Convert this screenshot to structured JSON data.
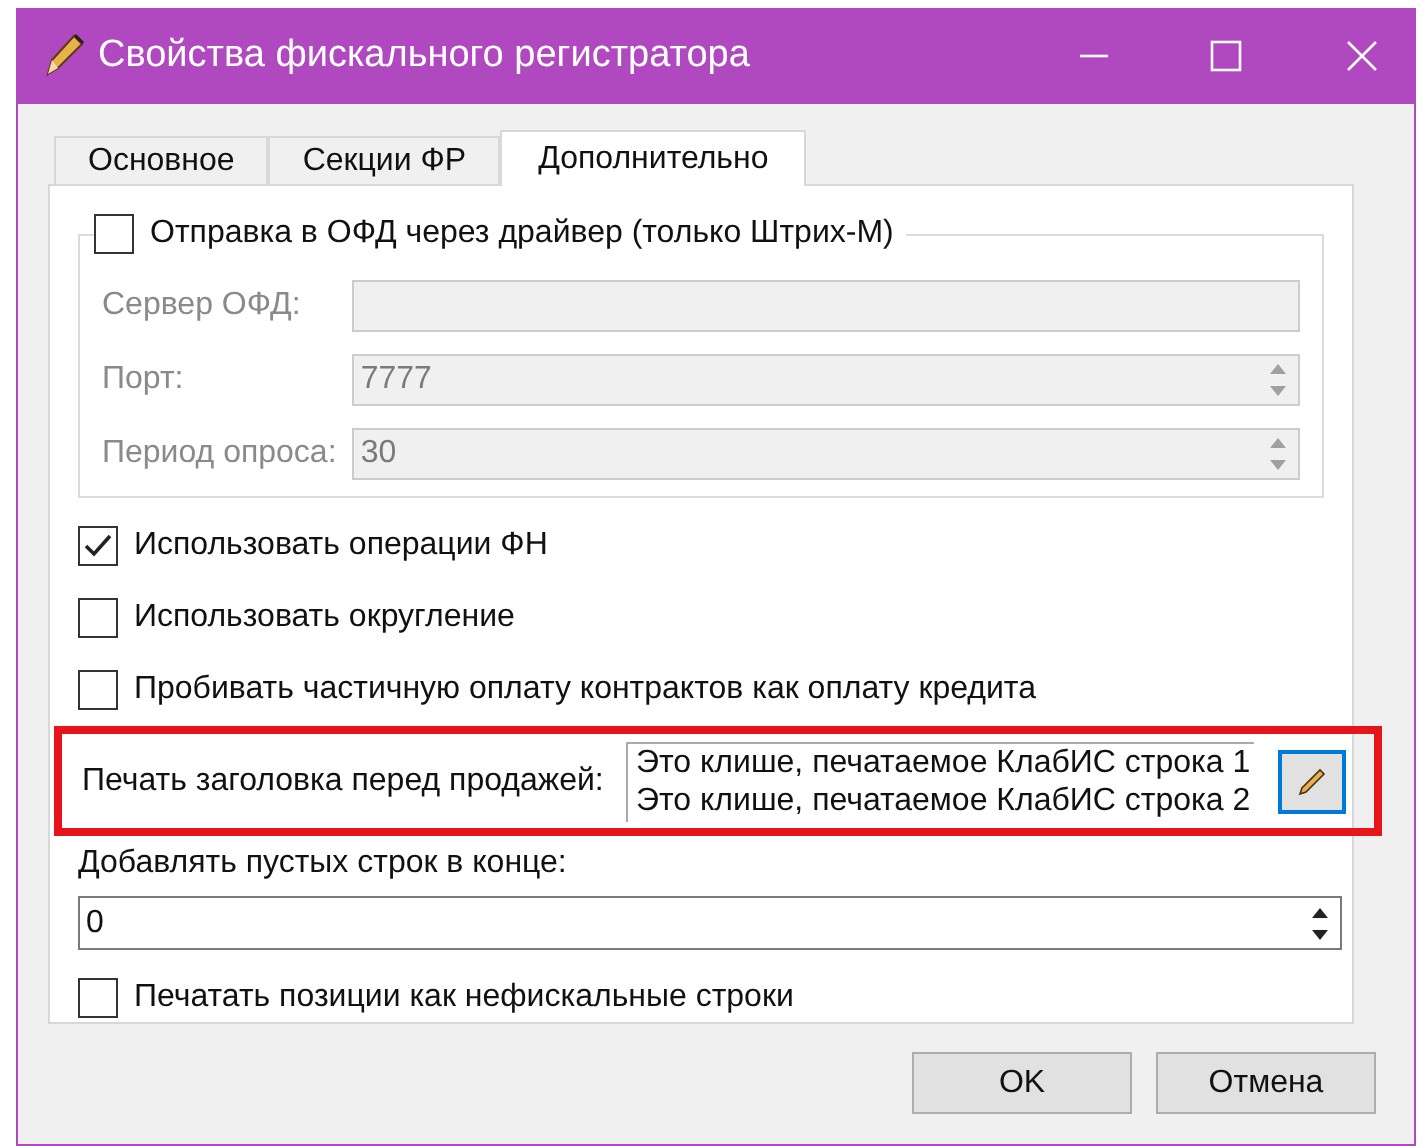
{
  "window": {
    "title": "Свойства фискального регистратора"
  },
  "tabs": [
    {
      "label": "Основное",
      "selected": false
    },
    {
      "label": "Секции ФР",
      "selected": false
    },
    {
      "label": "Дополнительно",
      "selected": true
    }
  ],
  "ofd_group": {
    "label": "Отправка в ОФД через драйвер (только Штрих-М)",
    "checked": false,
    "fields": [
      {
        "kind": "text",
        "label": "Сервер ОФД:",
        "disabled": true
      },
      {
        "kind": "spin",
        "label": "Порт:",
        "value": "7777",
        "disabled": true
      },
      {
        "kind": "spin",
        "label": "Период опроса:",
        "value": "30",
        "disabled": true
      }
    ]
  },
  "options": [
    {
      "label": "Использовать операции ФН",
      "checked": true
    },
    {
      "label": "Использовать округление",
      "checked": false
    },
    {
      "label": "Пробивать частичную оплату контрактов как оплату кредита",
      "checked": false
    }
  ],
  "header_print": {
    "label": "Печать заголовка перед продажей:",
    "highlighted": true,
    "lines": [
      "Это клише, печатаемое КлабИС строка 1",
      "Это клише, печатаемое КлабИС строка 2"
    ]
  },
  "blank_lines": {
    "label": "Добавлять пустых строк в конце:",
    "value": "0"
  },
  "final_option": {
    "label": "Печатать позиции как нефискальные строки",
    "checked": false
  },
  "buttons": [
    "OK",
    "Отмена"
  ]
}
